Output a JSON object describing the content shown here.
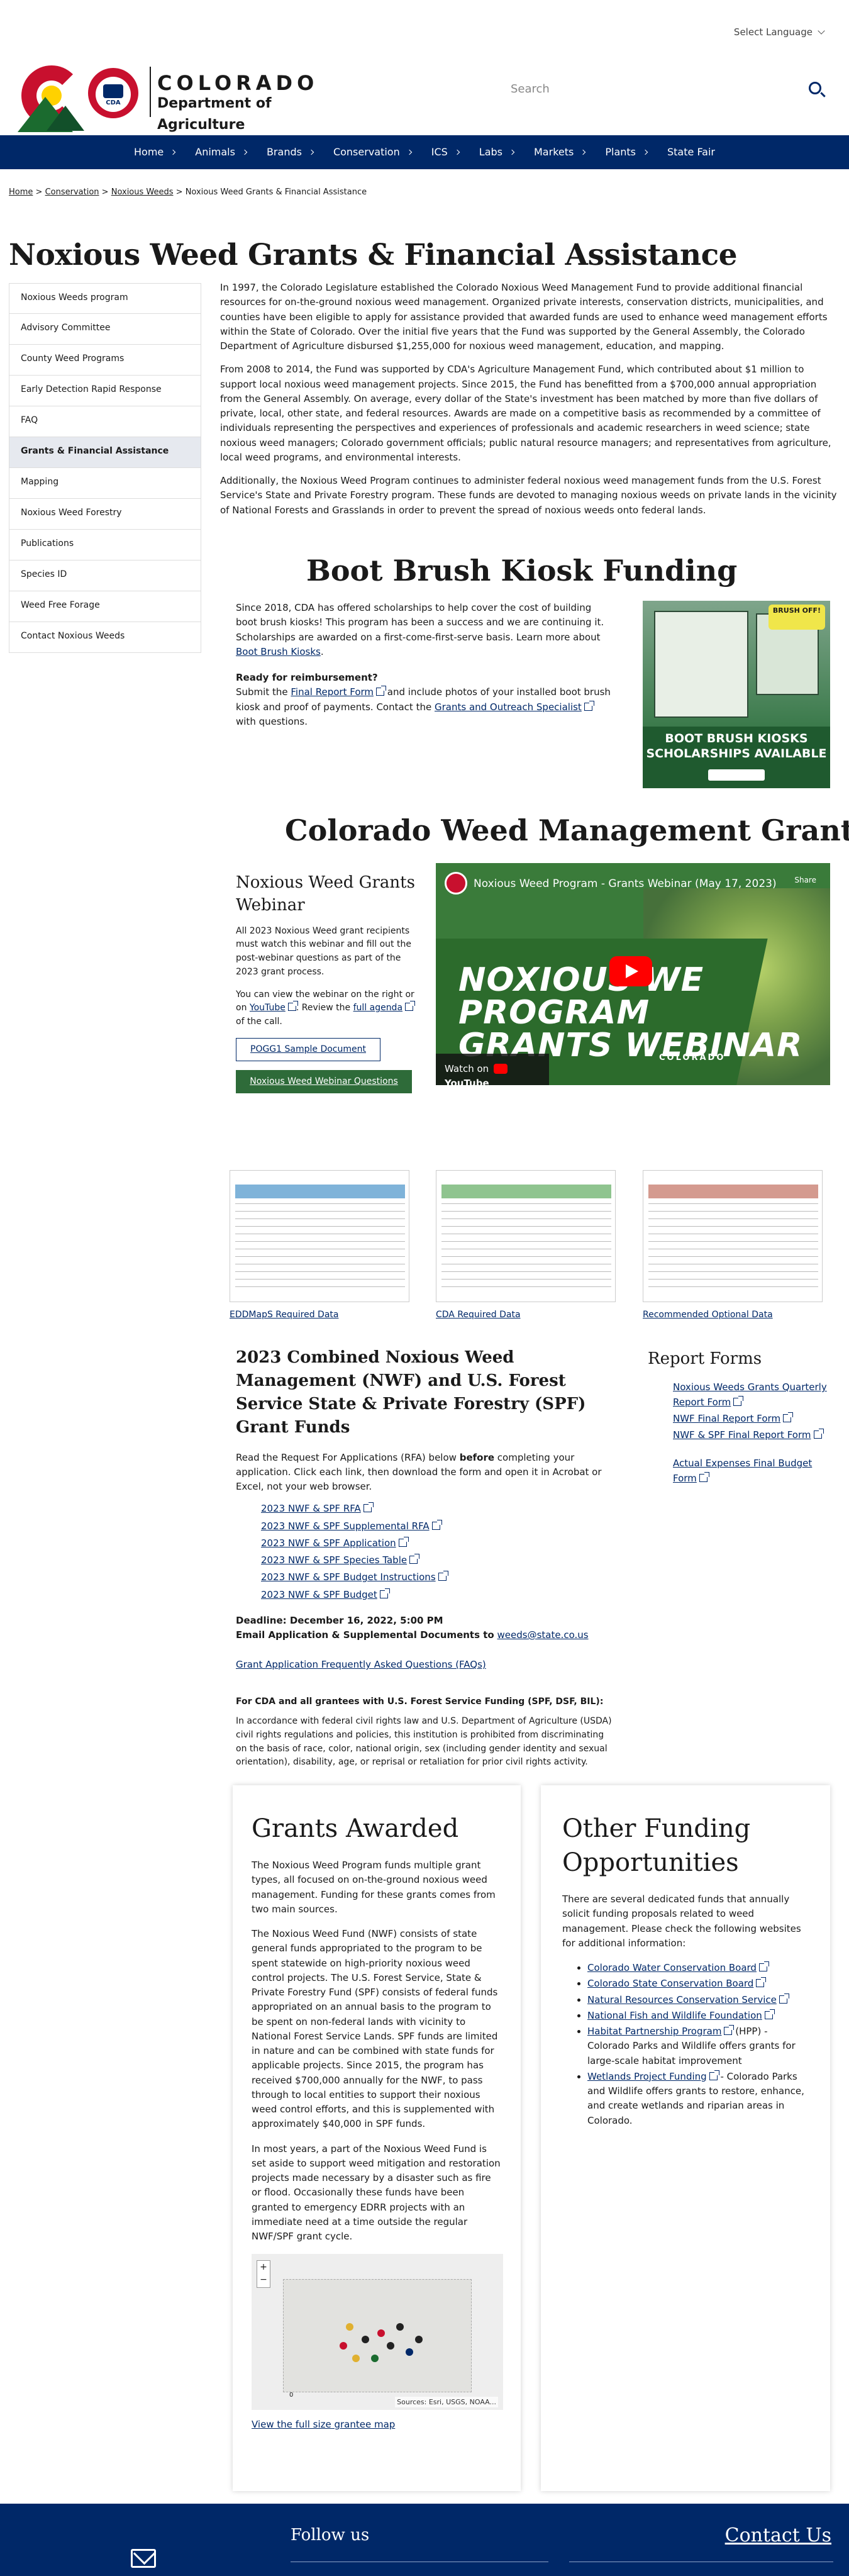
{
  "header": {
    "language": "Select Language",
    "logo_name": "COLORADO",
    "logo_dept": "Department of Agriculture",
    "logo_badge": "CDA",
    "search_placeholder": "Search"
  },
  "nav": [
    "Home",
    "Animals",
    "Brands",
    "Conservation",
    "ICS",
    "Labs",
    "Markets",
    "Plants",
    "State Fair"
  ],
  "breadcrumb": {
    "items": [
      "Home",
      "Conservation",
      "Noxious Weeds"
    ],
    "current": "Noxious Weed Grants & Financial Assistance",
    "separator": ">"
  },
  "page_title": "Noxious Weed Grants & Financial Assistance",
  "sidebar": [
    "Noxious Weeds program",
    "Advisory Committee",
    "County Weed Programs",
    "Early Detection Rapid Response",
    "FAQ",
    "Grants & Financial Assistance",
    "Mapping",
    "Noxious Weed Forestry",
    "Publications",
    "Species ID",
    "Weed Free Forage",
    "Contact Noxious Weeds"
  ],
  "intro": [
    "In 1997, the Colorado Legislature established the Colorado Noxious Weed Management Fund to provide additional financial resources for on-the-ground noxious weed management. Organized private interests, conservation districts, municipalities, and counties have been eligible to apply for assistance provided that awarded funds are used to enhance weed management efforts within the State of Colorado. Over the initial five years that the Fund was supported by the General Assembly, the Colorado Department of Agriculture disbursed $1,255,000 for noxious weed management, education, and mapping.",
    "From 2008 to 2014, the Fund was supported by CDA's Agriculture Management Fund, which contributed about $1 million to support local noxious weed management projects. Since 2015, the Fund has benefitted from a $700,000 annual appropriation from the General Assembly. On average, every dollar of the State's investment has been matched by more than five dollars of private, local, other state, and federal resources. Awards are made on a competitive basis as recommended by a committee of individuals representing the perspectives and experiences of professionals and academic researchers in weed science; state noxious weed managers; Colorado government officials; public natural resource managers; and representatives from agriculture, local weed programs, and environmental interests.",
    "Additionally, the Noxious Weed Program continues to administer federal noxious weed management funds from the U.S. Forest Service's State and Private Forestry program. These funds are devoted to managing noxious weeds on private lands in the vicinity of National Forests and Grasslands in order to prevent the spread of noxious weeds onto federal lands."
  ],
  "kiosk": {
    "heading": "Boot Brush Kiosk Funding",
    "p1": "Since 2018, CDA has offered scholarships to help cover the cost of building boot brush kiosks! This program has been a success and we are continuing it. Scholarships are awarded on a first-come-first-serve basis. Learn more about",
    "p1_link": "Boot Brush Kiosks",
    "p1_end": ".",
    "ready": "Ready for reimbursement?",
    "p2_a": "Submit the",
    "p2_link1": "Final Report Form",
    "p2_b": "and include photos of your installed boot brush kiosk and proof of payments. Contact the",
    "p2_link2": "Grants and Outreach Specialist",
    "p2_c": "with questions.",
    "image_banner": "BRUSH OFF!",
    "image_caption": "BOOT BRUSH KIOSKS SCHOLARSHIPS AVAILABLE"
  },
  "cwmg": {
    "heading": "Colorado Weed Management Grants",
    "webinar_title": "Noxious Weed Grants Webinar",
    "webinar_p1": "All 2023 Noxious Weed grant recipients must watch this webinar and fill out the post-webinar questions as part of the 2023 grant process.",
    "webinar_p2_a": "You can view the webinar on the right or on",
    "webinar_p2_link1": "YouTube",
    "webinar_p2_b": ". Review the",
    "webinar_p2_link2": "full agenda",
    "webinar_p2_c": "of the call.",
    "btn_pogg": "POGG1 Sample Document",
    "btn_questions": "Noxious Weed Webinar Questions",
    "video_title": "Noxious Weed Program - Grants Webinar (May 17, 2023)",
    "video_share": "Share",
    "video_big_1": "NOXIOUS WE",
    "video_big_2": "PROGRAM",
    "video_big_3": "GRANTS WEBINAR",
    "video_brand": "COLORADO",
    "video_watch": "Watch on",
    "video_yt": "YouTube"
  },
  "thumbnails": [
    {
      "label": "EDDMapS Required Data",
      "accent": "#7fb3d9"
    },
    {
      "label": "CDA Required Data",
      "accent": "#8fc48f"
    },
    {
      "label": "Recommended Optional Data",
      "accent": "#d49a8f"
    }
  ],
  "rfa": {
    "heading": "2023 Combined Noxious Weed Management (NWF) and U.S. Forest Service State & Private Forestry (SPF) Grant Funds",
    "p_a": "Read the Request For Applications (RFA) below",
    "p_bold": "before",
    "p_b": "completing your application. Click each link, then download the form and open it in Acrobat or Excel, not your web browser.",
    "links": [
      "2023 NWF & SPF RFA",
      "2023 NWF & SPF Supplemental RFA",
      "2023 NWF & SPF Application",
      "2023 NWF & SPF Species Table",
      "2023 NWF & SPF Budget Instructions",
      "2023 NWF & SPF Budget"
    ],
    "deadline": "Deadline: December 16, 2022, 5:00 PM",
    "email_label": "Email Application & Supplemental Documents to",
    "email": "weeds@state.co.us",
    "faq": "Grant Application Frequently Asked Questions (FAQs)",
    "usfs_heading": "For CDA and all grantees with U.S. Forest Service Funding (SPF, DSF, BIL):",
    "usfs_text": "In accordance with federal civil rights law and U.S. Department of Agriculture (USDA) civil rights regulations and policies, this institution is prohibited from discriminating on the basis of race, color, national origin, sex (including gender identity and sexual orientation), disability, age, or reprisal or retaliation for prior civil rights activity."
  },
  "report_forms": {
    "heading": "Report Forms",
    "links": [
      "Noxious Weeds Grants Quarterly Report Form",
      "NWF Final Report Form",
      "NWF & SPF Final Report Form",
      "Actual Expenses Final Budget Form"
    ]
  },
  "grants_awarded": {
    "heading": "Grants Awarded",
    "p1": "The Noxious Weed Program funds multiple grant types, all focused on on-the-ground noxious weed management. Funding for these grants comes from two main sources.",
    "p2": "The Noxious Weed Fund (NWF) consists of state general funds appropriated to the program to be spent statewide on high-priority noxious weed control projects. The U.S. Forest Service, State & Private Forestry Fund (SPF) consists of federal funds appropriated on an annual basis to the program to be spent on non-federal lands with vicinity to National Forest Service Lands. SPF funds are limited in nature and can be combined with state funds for applicable projects. Since 2015, the program has received $700,000 annually for the NWF, to pass through to local entities to support their noxious weed control efforts, and this is supplemented with approximately $40,000 in SPF funds.",
    "p3": "In most years, a part of the Noxious Weed Fund is set aside to support weed mitigation and restoration projects made necessary by a disaster such as fire or flood. Occasionally these funds have been granted to emergency EDRR projects with an immediate need at a time outside the regular NWF/SPF grant cycle.",
    "map_source": "Sources: Esri, USGS, NOAA...",
    "map_zoom_in": "+",
    "map_zoom_out": "−",
    "map_scale": "0",
    "map_link": "View the full size grantee map"
  },
  "other_funding": {
    "heading": "Other Funding Opportunities",
    "p1": "There are several dedicated funds that annually solicit funding proposals related to weed management. Please check the following websites for additional information:",
    "items": [
      {
        "link": "Colorado Water Conservation Board",
        "text": ""
      },
      {
        "link": "Colorado State Conservation Board",
        "text": ""
      },
      {
        "link": "Natural Resources Conservation Service",
        "text": ""
      },
      {
        "link": "National Fish and Wildlife Foundation",
        "text": ""
      },
      {
        "link": "Habitat Partnership Program",
        "text": "(HPP) - Colorado Parks and Wildlife offers grants for large-scale habitat improvement"
      },
      {
        "link": "Wetlands Project Funding",
        "text": "- Colorado Parks and Wildlife offers grants to restore, enhance, and create wetlands and riparian areas in Colorado."
      }
    ]
  },
  "footer": {
    "follow": "Follow us",
    "contact": "Contact Us"
  },
  "colors": {
    "brand_blue": "#002868",
    "brand_red": "#c8102e",
    "brand_green": "#2e6b39"
  }
}
